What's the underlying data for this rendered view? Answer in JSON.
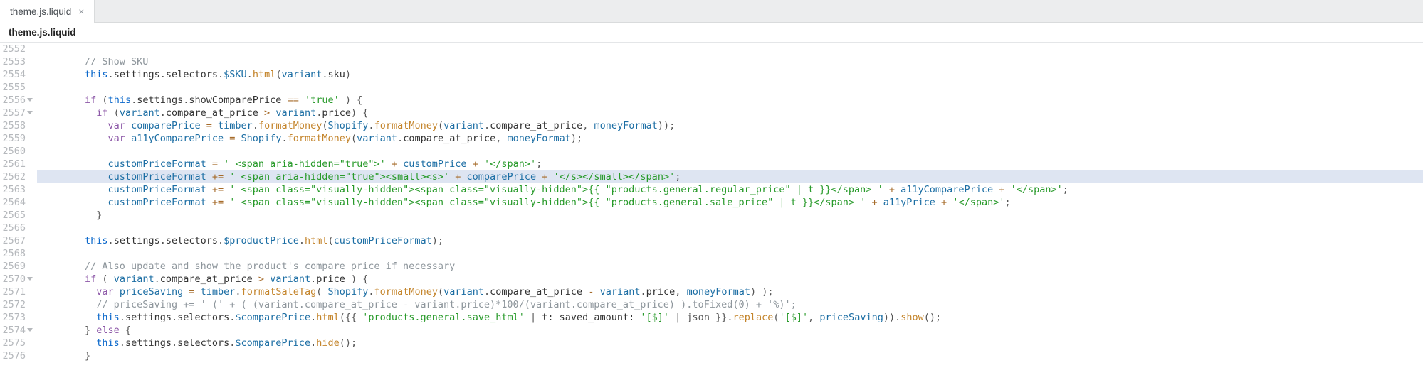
{
  "tab": {
    "name": "theme.js.liquid",
    "close": "×"
  },
  "title": "theme.js.liquid",
  "highlighted_row_index": 10,
  "lines": [
    {
      "num": "2552",
      "fold": false,
      "tokens": []
    },
    {
      "num": "2553",
      "fold": false,
      "tokens": [
        {
          "t": "        ",
          "c": ""
        },
        {
          "t": "// Show SKU",
          "c": "tk-comment"
        }
      ]
    },
    {
      "num": "2554",
      "fold": false,
      "tokens": [
        {
          "t": "        ",
          "c": ""
        },
        {
          "t": "this",
          "c": "tk-kw2"
        },
        {
          "t": ".",
          "c": "tk-punc"
        },
        {
          "t": "settings",
          "c": "tk-prop"
        },
        {
          "t": ".",
          "c": "tk-punc"
        },
        {
          "t": "selectors",
          "c": "tk-prop"
        },
        {
          "t": ".",
          "c": "tk-punc"
        },
        {
          "t": "$SKU",
          "c": "tk-ident"
        },
        {
          "t": ".",
          "c": "tk-punc"
        },
        {
          "t": "html",
          "c": "tk-call"
        },
        {
          "t": "(",
          "c": "tk-punc"
        },
        {
          "t": "variant",
          "c": "tk-ident"
        },
        {
          "t": ".",
          "c": "tk-punc"
        },
        {
          "t": "sku",
          "c": "tk-prop"
        },
        {
          "t": ")",
          "c": "tk-punc"
        }
      ]
    },
    {
      "num": "2555",
      "fold": false,
      "tokens": []
    },
    {
      "num": "2556",
      "fold": true,
      "tokens": [
        {
          "t": "        ",
          "c": ""
        },
        {
          "t": "if",
          "c": "tk-kw"
        },
        {
          "t": " (",
          "c": "tk-punc"
        },
        {
          "t": "this",
          "c": "tk-kw2"
        },
        {
          "t": ".",
          "c": "tk-punc"
        },
        {
          "t": "settings",
          "c": "tk-prop"
        },
        {
          "t": ".",
          "c": "tk-punc"
        },
        {
          "t": "showComparePrice",
          "c": "tk-prop"
        },
        {
          "t": " ",
          "c": ""
        },
        {
          "t": "==",
          "c": "tk-op"
        },
        {
          "t": " ",
          "c": ""
        },
        {
          "t": "'true'",
          "c": "tk-str"
        },
        {
          "t": " ) {",
          "c": "tk-punc"
        }
      ]
    },
    {
      "num": "2557",
      "fold": true,
      "tokens": [
        {
          "t": "          ",
          "c": ""
        },
        {
          "t": "if",
          "c": "tk-kw"
        },
        {
          "t": " (",
          "c": "tk-punc"
        },
        {
          "t": "variant",
          "c": "tk-ident"
        },
        {
          "t": ".",
          "c": "tk-punc"
        },
        {
          "t": "compare_at_price",
          "c": "tk-prop"
        },
        {
          "t": " ",
          "c": ""
        },
        {
          "t": ">",
          "c": "tk-op"
        },
        {
          "t": " ",
          "c": ""
        },
        {
          "t": "variant",
          "c": "tk-ident"
        },
        {
          "t": ".",
          "c": "tk-punc"
        },
        {
          "t": "price",
          "c": "tk-prop"
        },
        {
          "t": ") {",
          "c": "tk-punc"
        }
      ]
    },
    {
      "num": "2558",
      "fold": false,
      "tokens": [
        {
          "t": "            ",
          "c": ""
        },
        {
          "t": "var",
          "c": "tk-kw"
        },
        {
          "t": " ",
          "c": ""
        },
        {
          "t": "comparePrice",
          "c": "tk-ident"
        },
        {
          "t": " ",
          "c": ""
        },
        {
          "t": "=",
          "c": "tk-op"
        },
        {
          "t": " ",
          "c": ""
        },
        {
          "t": "timber",
          "c": "tk-ident"
        },
        {
          "t": ".",
          "c": "tk-punc"
        },
        {
          "t": "formatMoney",
          "c": "tk-call"
        },
        {
          "t": "(",
          "c": "tk-punc"
        },
        {
          "t": "Shopify",
          "c": "tk-ident"
        },
        {
          "t": ".",
          "c": "tk-punc"
        },
        {
          "t": "formatMoney",
          "c": "tk-call"
        },
        {
          "t": "(",
          "c": "tk-punc"
        },
        {
          "t": "variant",
          "c": "tk-ident"
        },
        {
          "t": ".",
          "c": "tk-punc"
        },
        {
          "t": "compare_at_price",
          "c": "tk-prop"
        },
        {
          "t": ", ",
          "c": "tk-punc"
        },
        {
          "t": "moneyFormat",
          "c": "tk-ident"
        },
        {
          "t": "));",
          "c": "tk-punc"
        }
      ]
    },
    {
      "num": "2559",
      "fold": false,
      "tokens": [
        {
          "t": "            ",
          "c": ""
        },
        {
          "t": "var",
          "c": "tk-kw"
        },
        {
          "t": " ",
          "c": ""
        },
        {
          "t": "a11yComparePrice",
          "c": "tk-ident"
        },
        {
          "t": " ",
          "c": ""
        },
        {
          "t": "=",
          "c": "tk-op"
        },
        {
          "t": " ",
          "c": ""
        },
        {
          "t": "Shopify",
          "c": "tk-ident"
        },
        {
          "t": ".",
          "c": "tk-punc"
        },
        {
          "t": "formatMoney",
          "c": "tk-call"
        },
        {
          "t": "(",
          "c": "tk-punc"
        },
        {
          "t": "variant",
          "c": "tk-ident"
        },
        {
          "t": ".",
          "c": "tk-punc"
        },
        {
          "t": "compare_at_price",
          "c": "tk-prop"
        },
        {
          "t": ", ",
          "c": "tk-punc"
        },
        {
          "t": "moneyFormat",
          "c": "tk-ident"
        },
        {
          "t": ");",
          "c": "tk-punc"
        }
      ]
    },
    {
      "num": "2560",
      "fold": false,
      "tokens": []
    },
    {
      "num": "2561",
      "fold": false,
      "tokens": [
        {
          "t": "            ",
          "c": ""
        },
        {
          "t": "customPriceFormat",
          "c": "tk-ident"
        },
        {
          "t": " ",
          "c": ""
        },
        {
          "t": "=",
          "c": "tk-op"
        },
        {
          "t": " ",
          "c": ""
        },
        {
          "t": "' <span aria-hidden=\"true\">'",
          "c": "tk-str"
        },
        {
          "t": " ",
          "c": ""
        },
        {
          "t": "+",
          "c": "tk-op"
        },
        {
          "t": " ",
          "c": ""
        },
        {
          "t": "customPrice",
          "c": "tk-ident"
        },
        {
          "t": " ",
          "c": ""
        },
        {
          "t": "+",
          "c": "tk-op"
        },
        {
          "t": " ",
          "c": ""
        },
        {
          "t": "'</span>'",
          "c": "tk-str"
        },
        {
          "t": ";",
          "c": "tk-punc"
        }
      ]
    },
    {
      "num": "2562",
      "fold": false,
      "tokens": [
        {
          "t": "            ",
          "c": ""
        },
        {
          "t": "customPriceFormat",
          "c": "tk-ident"
        },
        {
          "t": " ",
          "c": ""
        },
        {
          "t": "+=",
          "c": "tk-op"
        },
        {
          "t": " ",
          "c": ""
        },
        {
          "t": "' <span aria-hidden=\"true\"><small><s>'",
          "c": "tk-str"
        },
        {
          "t": " ",
          "c": ""
        },
        {
          "t": "+",
          "c": "tk-op"
        },
        {
          "t": " ",
          "c": ""
        },
        {
          "t": "comparePrice",
          "c": "tk-ident"
        },
        {
          "t": " ",
          "c": ""
        },
        {
          "t": "+",
          "c": "tk-op"
        },
        {
          "t": " ",
          "c": ""
        },
        {
          "t": "'</s></small></span>'",
          "c": "tk-str"
        },
        {
          "t": ";",
          "c": "tk-punc"
        }
      ]
    },
    {
      "num": "2563",
      "fold": false,
      "tokens": [
        {
          "t": "            ",
          "c": ""
        },
        {
          "t": "customPriceFormat",
          "c": "tk-ident"
        },
        {
          "t": " ",
          "c": ""
        },
        {
          "t": "+=",
          "c": "tk-op"
        },
        {
          "t": " ",
          "c": ""
        },
        {
          "t": "' <span class=\"visually-hidden\"><span class=\"visually-hidden\">{{ \"products.general.regular_price\" | t }}</span> '",
          "c": "tk-str"
        },
        {
          "t": " ",
          "c": ""
        },
        {
          "t": "+",
          "c": "tk-op"
        },
        {
          "t": " ",
          "c": ""
        },
        {
          "t": "a11yComparePrice",
          "c": "tk-ident"
        },
        {
          "t": " ",
          "c": ""
        },
        {
          "t": "+",
          "c": "tk-op"
        },
        {
          "t": " ",
          "c": ""
        },
        {
          "t": "'</span>'",
          "c": "tk-str"
        },
        {
          "t": ";",
          "c": "tk-punc"
        }
      ]
    },
    {
      "num": "2564",
      "fold": false,
      "tokens": [
        {
          "t": "            ",
          "c": ""
        },
        {
          "t": "customPriceFormat",
          "c": "tk-ident"
        },
        {
          "t": " ",
          "c": ""
        },
        {
          "t": "+=",
          "c": "tk-op"
        },
        {
          "t": " ",
          "c": ""
        },
        {
          "t": "' <span class=\"visually-hidden\"><span class=\"visually-hidden\">{{ \"products.general.sale_price\" | t }}</span> '",
          "c": "tk-str"
        },
        {
          "t": " ",
          "c": ""
        },
        {
          "t": "+",
          "c": "tk-op"
        },
        {
          "t": " ",
          "c": ""
        },
        {
          "t": "a11yPrice",
          "c": "tk-ident"
        },
        {
          "t": " ",
          "c": ""
        },
        {
          "t": "+",
          "c": "tk-op"
        },
        {
          "t": " ",
          "c": ""
        },
        {
          "t": "'</span>'",
          "c": "tk-str"
        },
        {
          "t": ";",
          "c": "tk-punc"
        }
      ]
    },
    {
      "num": "2565",
      "fold": false,
      "tokens": [
        {
          "t": "          }",
          "c": "tk-punc"
        }
      ]
    },
    {
      "num": "2566",
      "fold": false,
      "tokens": []
    },
    {
      "num": "2567",
      "fold": false,
      "tokens": [
        {
          "t": "        ",
          "c": ""
        },
        {
          "t": "this",
          "c": "tk-kw2"
        },
        {
          "t": ".",
          "c": "tk-punc"
        },
        {
          "t": "settings",
          "c": "tk-prop"
        },
        {
          "t": ".",
          "c": "tk-punc"
        },
        {
          "t": "selectors",
          "c": "tk-prop"
        },
        {
          "t": ".",
          "c": "tk-punc"
        },
        {
          "t": "$productPrice",
          "c": "tk-ident"
        },
        {
          "t": ".",
          "c": "tk-punc"
        },
        {
          "t": "html",
          "c": "tk-call"
        },
        {
          "t": "(",
          "c": "tk-punc"
        },
        {
          "t": "customPriceFormat",
          "c": "tk-ident"
        },
        {
          "t": ");",
          "c": "tk-punc"
        }
      ]
    },
    {
      "num": "2568",
      "fold": false,
      "tokens": []
    },
    {
      "num": "2569",
      "fold": false,
      "tokens": [
        {
          "t": "        ",
          "c": ""
        },
        {
          "t": "// Also update and show the product's compare price if necessary",
          "c": "tk-comment"
        }
      ]
    },
    {
      "num": "2570",
      "fold": true,
      "tokens": [
        {
          "t": "        ",
          "c": ""
        },
        {
          "t": "if",
          "c": "tk-kw"
        },
        {
          "t": " ( ",
          "c": "tk-punc"
        },
        {
          "t": "variant",
          "c": "tk-ident"
        },
        {
          "t": ".",
          "c": "tk-punc"
        },
        {
          "t": "compare_at_price",
          "c": "tk-prop"
        },
        {
          "t": " ",
          "c": ""
        },
        {
          "t": ">",
          "c": "tk-op"
        },
        {
          "t": " ",
          "c": ""
        },
        {
          "t": "variant",
          "c": "tk-ident"
        },
        {
          "t": ".",
          "c": "tk-punc"
        },
        {
          "t": "price",
          "c": "tk-prop"
        },
        {
          "t": " ) {",
          "c": "tk-punc"
        }
      ]
    },
    {
      "num": "2571",
      "fold": false,
      "tokens": [
        {
          "t": "          ",
          "c": ""
        },
        {
          "t": "var",
          "c": "tk-kw"
        },
        {
          "t": " ",
          "c": ""
        },
        {
          "t": "priceSaving",
          "c": "tk-ident"
        },
        {
          "t": " ",
          "c": ""
        },
        {
          "t": "=",
          "c": "tk-op"
        },
        {
          "t": " ",
          "c": ""
        },
        {
          "t": "timber",
          "c": "tk-ident"
        },
        {
          "t": ".",
          "c": "tk-punc"
        },
        {
          "t": "formatSaleTag",
          "c": "tk-call"
        },
        {
          "t": "( ",
          "c": "tk-punc"
        },
        {
          "t": "Shopify",
          "c": "tk-ident"
        },
        {
          "t": ".",
          "c": "tk-punc"
        },
        {
          "t": "formatMoney",
          "c": "tk-call"
        },
        {
          "t": "(",
          "c": "tk-punc"
        },
        {
          "t": "variant",
          "c": "tk-ident"
        },
        {
          "t": ".",
          "c": "tk-punc"
        },
        {
          "t": "compare_at_price",
          "c": "tk-prop"
        },
        {
          "t": " ",
          "c": ""
        },
        {
          "t": "-",
          "c": "tk-op"
        },
        {
          "t": " ",
          "c": ""
        },
        {
          "t": "variant",
          "c": "tk-ident"
        },
        {
          "t": ".",
          "c": "tk-punc"
        },
        {
          "t": "price",
          "c": "tk-prop"
        },
        {
          "t": ", ",
          "c": "tk-punc"
        },
        {
          "t": "moneyFormat",
          "c": "tk-ident"
        },
        {
          "t": ") );",
          "c": "tk-punc"
        }
      ]
    },
    {
      "num": "2572",
      "fold": false,
      "tokens": [
        {
          "t": "          ",
          "c": ""
        },
        {
          "t": "// priceSaving += ' (' + ( (variant.compare_at_price - variant.price)*100/(variant.compare_at_price) ).toFixed(0) + '%)';",
          "c": "tk-comment"
        }
      ]
    },
    {
      "num": "2573",
      "fold": false,
      "tokens": [
        {
          "t": "          ",
          "c": ""
        },
        {
          "t": "this",
          "c": "tk-kw2"
        },
        {
          "t": ".",
          "c": "tk-punc"
        },
        {
          "t": "settings",
          "c": "tk-prop"
        },
        {
          "t": ".",
          "c": "tk-punc"
        },
        {
          "t": "selectors",
          "c": "tk-prop"
        },
        {
          "t": ".",
          "c": "tk-punc"
        },
        {
          "t": "$comparePrice",
          "c": "tk-ident"
        },
        {
          "t": ".",
          "c": "tk-punc"
        },
        {
          "t": "html",
          "c": "tk-call"
        },
        {
          "t": "(",
          "c": "tk-punc"
        },
        {
          "t": "{{ ",
          "c": "tk-punc"
        },
        {
          "t": "'products.general.save_html'",
          "c": "tk-str"
        },
        {
          "t": " | ",
          "c": "tk-punc"
        },
        {
          "t": "t: saved_amount: ",
          "c": "tk-prop"
        },
        {
          "t": "'[$]'",
          "c": "tk-str"
        },
        {
          "t": " | json }}",
          "c": "tk-punc"
        },
        {
          "t": ".",
          "c": "tk-punc"
        },
        {
          "t": "replace",
          "c": "tk-call"
        },
        {
          "t": "(",
          "c": "tk-punc"
        },
        {
          "t": "'[$]'",
          "c": "tk-str"
        },
        {
          "t": ", ",
          "c": "tk-punc"
        },
        {
          "t": "priceSaving",
          "c": "tk-ident"
        },
        {
          "t": ")).",
          "c": "tk-punc"
        },
        {
          "t": "show",
          "c": "tk-call"
        },
        {
          "t": "();",
          "c": "tk-punc"
        }
      ]
    },
    {
      "num": "2574",
      "fold": true,
      "tokens": [
        {
          "t": "        } ",
          "c": "tk-punc"
        },
        {
          "t": "else",
          "c": "tk-kw"
        },
        {
          "t": " {",
          "c": "tk-punc"
        }
      ]
    },
    {
      "num": "2575",
      "fold": false,
      "tokens": [
        {
          "t": "          ",
          "c": ""
        },
        {
          "t": "this",
          "c": "tk-kw2"
        },
        {
          "t": ".",
          "c": "tk-punc"
        },
        {
          "t": "settings",
          "c": "tk-prop"
        },
        {
          "t": ".",
          "c": "tk-punc"
        },
        {
          "t": "selectors",
          "c": "tk-prop"
        },
        {
          "t": ".",
          "c": "tk-punc"
        },
        {
          "t": "$comparePrice",
          "c": "tk-ident"
        },
        {
          "t": ".",
          "c": "tk-punc"
        },
        {
          "t": "hide",
          "c": "tk-call"
        },
        {
          "t": "();",
          "c": "tk-punc"
        }
      ]
    },
    {
      "num": "2576",
      "fold": false,
      "tokens": [
        {
          "t": "        }",
          "c": "tk-punc"
        }
      ]
    }
  ]
}
